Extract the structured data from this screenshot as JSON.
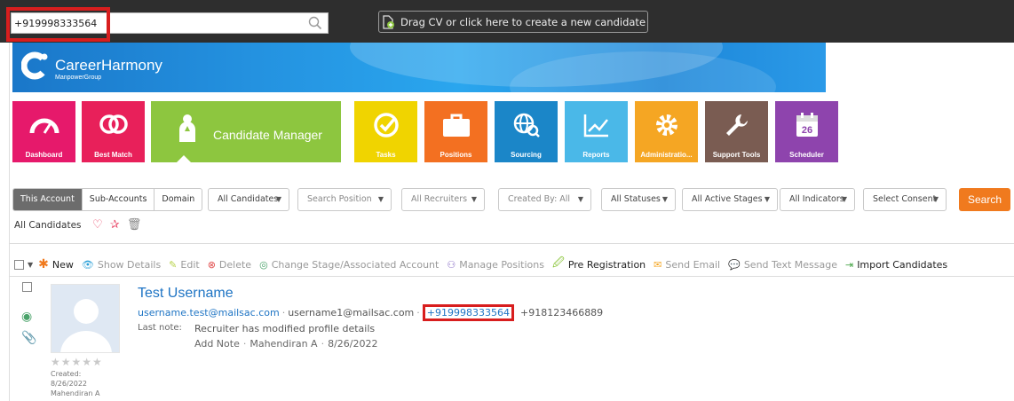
{
  "topbar": {
    "search_value": "+919998333564",
    "drag_label": "Drag CV or click here to create a new candidate"
  },
  "brand": {
    "name": "CareerHarmony",
    "sub": "ManpowerGroup"
  },
  "tiles": [
    {
      "label": "Dashboard",
      "color": "#e6196b"
    },
    {
      "label": "Best Match",
      "color": "#e8205a"
    },
    {
      "label": "Candidate Manager",
      "color": "#8dc63f"
    },
    {
      "label": "Tasks",
      "color": "#f0d400"
    },
    {
      "label": "Positions",
      "color": "#f37021"
    },
    {
      "label": "Sourcing",
      "color": "#1b86c8"
    },
    {
      "label": "Reports",
      "color": "#4ab8e8"
    },
    {
      "label": "Administratio...",
      "color": "#f5a623"
    },
    {
      "label": "Support Tools",
      "color": "#7a5c52"
    },
    {
      "label": "Scheduler",
      "color": "#8e44ad",
      "badge": "26"
    }
  ],
  "filters": {
    "scope": [
      "This Account",
      "Sub-Accounts",
      "Domain"
    ],
    "dropdowns": [
      "All Candidates",
      "Search Position",
      "All Recruiters",
      "Created By: All",
      "All Statuses",
      "All Active Stages",
      "All Indicators",
      "Select Consent"
    ],
    "search_label": "Search"
  },
  "saved_view": "All Candidates",
  "actions": {
    "new": "New",
    "show_details": "Show Details",
    "edit": "Edit",
    "delete": "Delete",
    "change_stage": "Change Stage/Associated Account",
    "manage_positions": "Manage Positions",
    "pre_registration": "Pre Registration",
    "send_email": "Send Email",
    "send_text": "Send Text Message",
    "import": "Import Candidates"
  },
  "candidate": {
    "name": "Test Username",
    "email1": "username.test@mailsac.com",
    "email2": "username1@mailsac.com",
    "phone1": "+919998333564",
    "phone2": "+918123466889",
    "last_note_label": "Last note:",
    "last_note": "Recruiter has modified profile details",
    "add_note": "Add Note",
    "note_author": "Mahendiran A",
    "note_date": "8/26/2022",
    "stars": "★★★★★",
    "created_label": "Created:",
    "created_date": "8/26/2022",
    "created_by": "Mahendiran A"
  }
}
